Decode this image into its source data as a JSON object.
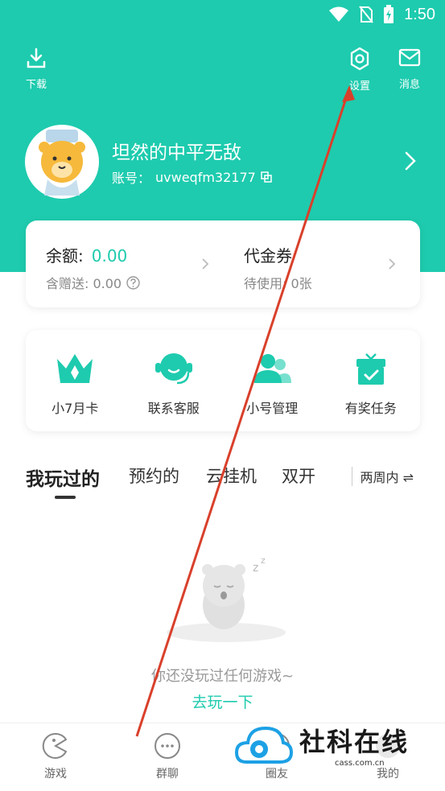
{
  "status_bar": {
    "time": "1:50"
  },
  "header": {
    "download_label": "下载",
    "settings_label": "设置",
    "messages_label": "消息"
  },
  "profile": {
    "nickname": "坦然的中平无敌",
    "account_prefix": "账号：",
    "account_id": "uvweqfm32177"
  },
  "balance": {
    "balance_label": "余额:",
    "balance_value": "0.00",
    "gift_label": "含赠送: 0.00",
    "voucher_label": "代金券",
    "voucher_pending": "待使用: 0张"
  },
  "quick_actions": [
    {
      "label": "小7月卡",
      "icon": "crown-icon"
    },
    {
      "label": "联系客服",
      "icon": "headset-icon"
    },
    {
      "label": "小号管理",
      "icon": "users-icon"
    },
    {
      "label": "有奖任务",
      "icon": "gift-icon"
    }
  ],
  "tabs": [
    {
      "label": "我玩过的",
      "active": true
    },
    {
      "label": "预约的",
      "active": false
    },
    {
      "label": "云挂机",
      "active": false
    },
    {
      "label": "双开",
      "active": false
    }
  ],
  "period_filter": "两周内 ⇌",
  "empty_state": {
    "message": "你还没玩过任何游戏~",
    "action": "去玩一下"
  },
  "bottom_nav": [
    {
      "label": "游戏",
      "icon": "pacman-icon"
    },
    {
      "label": "群聊",
      "icon": "chat-icon"
    },
    {
      "label": "圈友",
      "icon": "circle-icon"
    },
    {
      "label": "我的",
      "icon": "profile-icon"
    }
  ],
  "watermark": {
    "text": "社科在线",
    "url": "cass.com.cn"
  },
  "colors": {
    "accent": "#1ecbae",
    "annotation_arrow": "#d9402b"
  }
}
